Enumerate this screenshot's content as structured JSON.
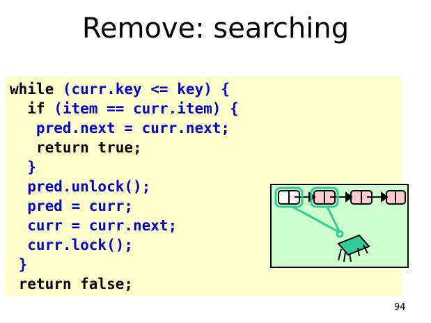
{
  "slide": {
    "title": "Remove: searching",
    "page_number": "94"
  },
  "code": {
    "lines": [
      [
        {
          "t": "while ",
          "c": "black"
        },
        {
          "t": "(curr.key <= key) {",
          "c": "blue"
        }
      ],
      [
        {
          "t": "  if ",
          "c": "black"
        },
        {
          "t": "(item == curr.item) {",
          "c": "blue"
        }
      ],
      [
        {
          "t": "   pred.next = curr.next;",
          "c": "blue"
        }
      ],
      [
        {
          "t": "   return true;",
          "c": "black"
        }
      ],
      [
        {
          "t": "  }",
          "c": "blue"
        }
      ],
      [
        {
          "t": "  pred.unlock();",
          "c": "blue"
        }
      ],
      [
        {
          "t": "  pred = curr;",
          "c": "blue"
        }
      ],
      [
        {
          "t": "  curr = curr.next;",
          "c": "blue"
        }
      ],
      [
        {
          "t": "  curr.lock();",
          "c": "blue"
        }
      ],
      [
        {
          "t": " }",
          "c": "blue"
        }
      ],
      [
        {
          "t": " return false;",
          "c": "black"
        }
      ]
    ]
  },
  "colors": {
    "code_background": "#ffffcc",
    "code_blue": "#0000cc",
    "diagram_background": "#ccffcc",
    "lock_highlight": "#33cc99",
    "node_fill": "#ffcccc"
  },
  "diagram": {
    "icons": [
      "list-node-icon",
      "list-node-icon",
      "list-node-icon",
      "list-node-icon",
      "thread-icon"
    ]
  }
}
